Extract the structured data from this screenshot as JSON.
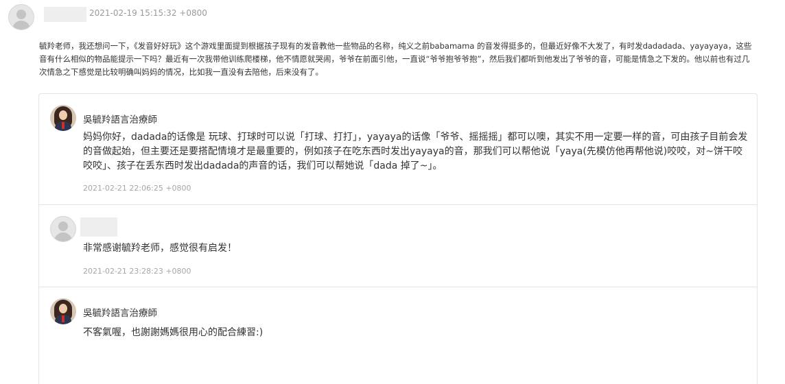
{
  "post": {
    "timestamp": "2021-02-19 15:15:32 +0800",
    "body": "毓羚老师，我还想问一下，《发音好好玩》这个游戏里面提到根据孩子现有的发音教他一些物品的名称，纯义之前babamama 的音发得挺多的，但最近好像不大发了，有时发dadadada、yayayaya，这些音有什么相似的物品能提示一下吗？最近有一次我带他训练爬楼梯，他不情愿就哭闹，爷爷在前面引他，一直说“爷爷抱爷爷抱”，然后我们都听到他发出了爷爷的音，可能是情急之下发的。他以前也有过几次情急之下感觉是比较明确叫妈妈的情况，比如我一直没有去陪他，后来没有了。"
  },
  "replies": [
    {
      "author": "吳毓羚語言治療師",
      "content": "妈妈你好，dadada的话像是 玩球、打球时可以说「打球、打打」，yayaya的话像「爷爷、摇摇摇」都可以噢，其实不用一定要一样的音，可由孩子目前会发的音做起始，但主要还是要搭配情境才是最重要的，例如孩子在吃东西时发出yayaya的音，那我们可以帮他说「yaya(先模仿他再帮他说)咬咬，对~饼干咬咬咬」、孩子在丢东西时发出dadada的声音的话，我们可以帮她说「dada 掉了~」。",
      "timestamp": "2021-02-21 22:06:25 +0800"
    },
    {
      "author": "",
      "content": "非常感谢毓羚老师，感觉很有启发！",
      "timestamp": "2021-02-21 23:28:23 +0800"
    },
    {
      "author": "吳毓羚語言治療師",
      "content": "不客氣喔，也謝謝媽媽很用心的配合練習:)",
      "timestamp": ""
    }
  ]
}
